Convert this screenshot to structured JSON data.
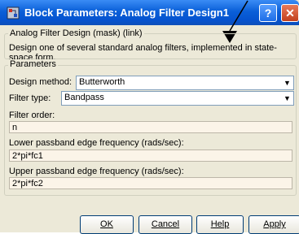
{
  "window": {
    "title": "Block Parameters: Analog Filter Design1",
    "help_btn": "?",
    "close_btn_icon": "close-icon",
    "app_icon": "simulink-icon"
  },
  "mask_group": {
    "legend": "Analog Filter Design (mask) (link)",
    "description": "Design one of several standard analog filters, implemented in state-space form."
  },
  "params_group": {
    "legend": "Parameters",
    "design_method_label": "Design method:",
    "design_method_value": "Butterworth",
    "filter_type_label": "Filter type:",
    "filter_type_value": "Bandpass",
    "filter_order_label": "Filter order:",
    "filter_order_value": "n",
    "lower_label": "Lower passband edge frequency (rads/sec):",
    "lower_value": "2*pi*fc1",
    "upper_label": "Upper passband edge frequency (rads/sec):",
    "upper_value": "2*pi*fc2"
  },
  "buttons": {
    "ok": "OK",
    "cancel": "Cancel",
    "help": "Help",
    "apply": "Apply"
  },
  "colors": {
    "titlebar": "#0a5fd8",
    "dialog_bg": "#ece9d8",
    "edit_bg": "#fbf4e8"
  }
}
